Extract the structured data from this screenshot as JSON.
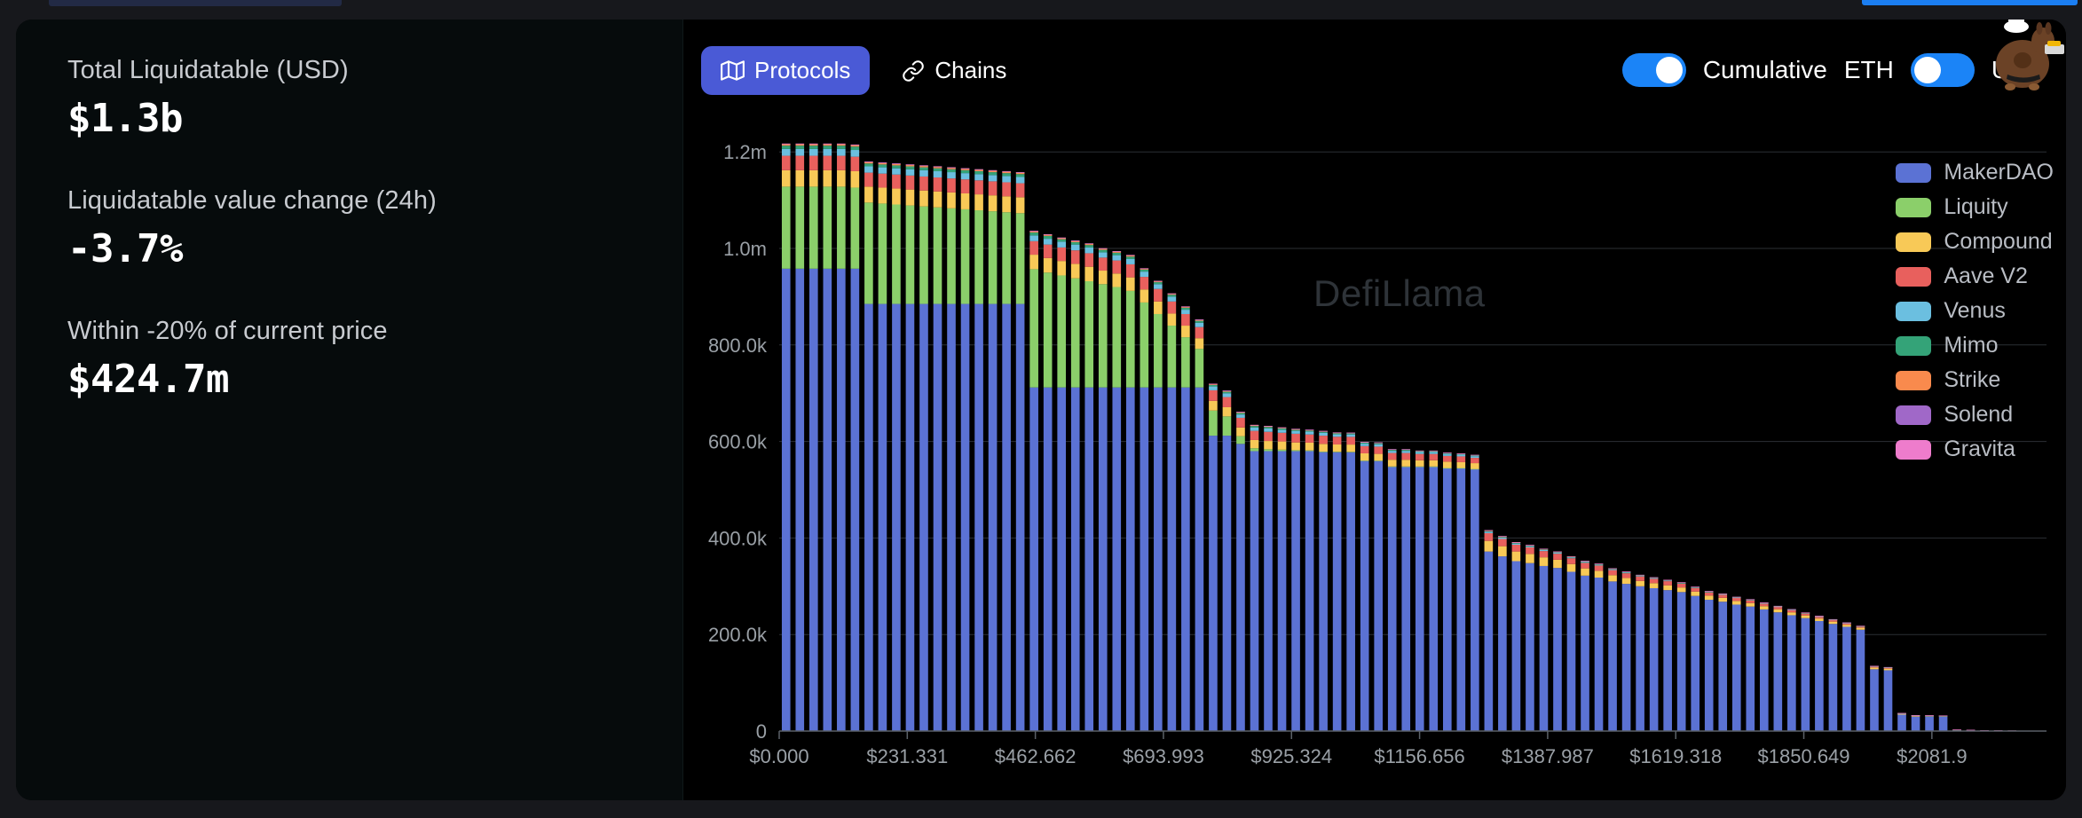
{
  "stats": [
    {
      "label": "Total Liquidatable (USD)",
      "value": "$1.3b"
    },
    {
      "label": "Liquidatable value change (24h)",
      "value": "-3.7%"
    },
    {
      "label": "Within -20% of current price",
      "value": "$424.7m"
    }
  ],
  "toolbar": {
    "tabs": [
      {
        "label": "Protocols",
        "icon": "map-icon",
        "active": true
      },
      {
        "label": "Chains",
        "icon": "link-icon",
        "active": false
      }
    ],
    "cumulative_toggle": {
      "label": "Cumulative",
      "state": "on"
    },
    "currency_toggle": {
      "left_label": "ETH",
      "right_label": "USD",
      "state": "off"
    }
  },
  "watermark": "DefiLlama",
  "colors": {
    "accent_blue": "#4a5ad6",
    "toggle_blue": "#1b84f7",
    "card_bg": "#000000",
    "stats_bg": "#060b0c",
    "grid": "#2b2f34",
    "axis_text": "#9aa0a6"
  },
  "chart_data": {
    "type": "bar",
    "title": "",
    "xlabel": "",
    "ylabel": "",
    "stacked": true,
    "cumulative": true,
    "grid": true,
    "legend_position": "right",
    "ylim": [
      0,
      1250000
    ],
    "ytick_labels": [
      "0",
      "200.0k",
      "400.0k",
      "600.0k",
      "800.0k",
      "1.0m",
      "1.2m"
    ],
    "ytick_values": [
      0,
      200000,
      400000,
      600000,
      800000,
      1000000,
      1200000
    ],
    "xlim": [
      0,
      2289.0
    ],
    "xtick_labels": [
      "$0.000",
      "$231.331",
      "$462.662",
      "$693.993",
      "$925.324",
      "$1156.656",
      "$1387.987",
      "$1619.318",
      "$1850.649",
      "$2081.9"
    ],
    "xtick_values": [
      0.0,
      231.331,
      462.662,
      693.993,
      925.324,
      1156.656,
      1387.987,
      1619.318,
      1850.649,
      2081.98
    ],
    "series": [
      {
        "name": "MakerDAO",
        "color": "#5b72d4",
        "values": [
          958000,
          958000,
          958000,
          958000,
          958000,
          958000,
          885000,
          885000,
          885000,
          885000,
          885000,
          885000,
          885000,
          885000,
          885000,
          885000,
          885000,
          885000,
          712000,
          712000,
          712000,
          712000,
          712000,
          712000,
          712000,
          712000,
          712000,
          712000,
          712000,
          712000,
          712000,
          612000,
          612000,
          595000,
          580000,
          580000,
          580000,
          580000,
          580000,
          578000,
          578000,
          578000,
          560000,
          560000,
          548000,
          548000,
          548000,
          548000,
          545000,
          545000,
          543000,
          372000,
          362000,
          352000,
          348000,
          342000,
          338000,
          330000,
          322000,
          318000,
          310000,
          305000,
          300000,
          296000,
          292000,
          288000,
          280000,
          272000,
          268000,
          262000,
          258000,
          252000,
          246000,
          240000,
          234000,
          228000,
          222000,
          216000,
          210000,
          128000,
          126000,
          34000,
          30000,
          30000,
          30000,
          2000,
          1500,
          1000,
          800,
          600,
          400,
          300
        ]
      },
      {
        "name": "Liquity",
        "color": "#8bcf6a",
        "values": [
          170000,
          170000,
          170000,
          170000,
          170000,
          168000,
          210000,
          208000,
          206000,
          204000,
          202000,
          200000,
          198000,
          196000,
          194000,
          192000,
          190000,
          188000,
          245000,
          238000,
          232000,
          226000,
          220000,
          214000,
          208000,
          200000,
          176000,
          152000,
          128000,
          104000,
          80000,
          52000,
          40000,
          16000,
          6000,
          4000,
          3000,
          2000,
          1500,
          1000,
          800,
          600,
          400,
          300,
          200,
          150,
          120,
          100,
          80,
          60,
          50,
          0,
          0,
          0,
          0,
          0,
          0,
          0,
          0,
          0,
          0,
          0,
          0,
          0,
          0,
          0,
          0,
          0,
          0,
          0,
          0,
          0,
          0,
          0,
          0,
          0,
          0,
          0,
          0,
          0,
          0,
          0,
          0,
          0,
          0,
          0,
          0,
          0,
          0,
          0,
          0,
          0
        ]
      },
      {
        "name": "Compound",
        "color": "#f8c957",
        "values": [
          34000,
          34000,
          34000,
          34000,
          34000,
          34000,
          33000,
          33000,
          33000,
          33000,
          33000,
          33000,
          33000,
          33000,
          33000,
          33000,
          33000,
          33000,
          30000,
          30000,
          30000,
          30000,
          30000,
          28000,
          28000,
          28000,
          27000,
          26000,
          25000,
          24000,
          22000,
          20000,
          19000,
          18000,
          17000,
          17000,
          17000,
          16000,
          16000,
          16000,
          15000,
          15000,
          15000,
          14000,
          14000,
          14000,
          13000,
          13000,
          13000,
          12000,
          12000,
          22000,
          21000,
          20000,
          19000,
          18000,
          17000,
          16000,
          15000,
          14000,
          13000,
          12000,
          11000,
          10500,
          10000,
          9500,
          9000,
          8500,
          8000,
          7600,
          7200,
          6800,
          6400,
          6000,
          5600,
          5200,
          4800,
          4400,
          4000,
          3600,
          3400,
          1600,
          1400,
          1200,
          1000,
          300,
          250,
          200,
          160,
          120,
          90,
          60
        ]
      },
      {
        "name": "Aave V2",
        "color": "#e8605d",
        "values": [
          30000,
          30000,
          30000,
          30000,
          30000,
          30000,
          29000,
          29000,
          29000,
          29000,
          29000,
          29000,
          29000,
          29000,
          29000,
          29000,
          29000,
          29000,
          28000,
          28000,
          28000,
          28000,
          28000,
          27000,
          27000,
          27000,
          26000,
          26000,
          25000,
          24000,
          23000,
          22000,
          21000,
          20000,
          19000,
          19000,
          18000,
          18000,
          17000,
          17000,
          16000,
          16000,
          15000,
          15000,
          14000,
          14000,
          13000,
          13000,
          12000,
          12000,
          11000,
          16000,
          15000,
          14000,
          13500,
          13000,
          12500,
          12000,
          11500,
          11000,
          10500,
          10000,
          9500,
          9000,
          8500,
          8000,
          7500,
          7000,
          6600,
          6200,
          5800,
          5400,
          5000,
          4600,
          4200,
          3800,
          3400,
          3000,
          2600,
          2200,
          2000,
          900,
          800,
          700,
          600,
          200,
          160,
          130,
          100,
          80,
          60,
          40
        ]
      },
      {
        "name": "Venus",
        "color": "#6bbfe0",
        "values": [
          14000,
          14000,
          14000,
          14000,
          14000,
          14000,
          13000,
          13000,
          13000,
          13000,
          13000,
          13000,
          13000,
          13000,
          13000,
          13000,
          13000,
          13000,
          12000,
          12000,
          12000,
          12000,
          12000,
          11000,
          11000,
          11000,
          11000,
          10000,
          10000,
          9000,
          9000,
          8000,
          8000,
          7000,
          7000,
          7000,
          6000,
          6000,
          6000,
          6000,
          5000,
          5000,
          5000,
          5000,
          4500,
          4500,
          4000,
          4000,
          4000,
          3500,
          3500,
          3000,
          2800,
          2600,
          2400,
          2200,
          2000,
          1900,
          1800,
          1700,
          1600,
          1500,
          1400,
          1300,
          1200,
          1100,
          1000,
          950,
          900,
          850,
          800,
          750,
          700,
          650,
          600,
          550,
          500,
          450,
          400,
          300,
          280,
          120,
          110,
          100,
          90,
          40,
          35,
          30,
          25,
          20,
          15,
          10
        ]
      },
      {
        "name": "Mimo",
        "color": "#34a378",
        "values": [
          7000,
          7000,
          7000,
          7000,
          7000,
          7000,
          6000,
          6000,
          6000,
          6000,
          6000,
          6000,
          6000,
          6000,
          6000,
          6000,
          6000,
          6000,
          6000,
          6000,
          5000,
          5000,
          5000,
          5000,
          5000,
          5000,
          4000,
          4000,
          4000,
          4000,
          4000,
          3000,
          3000,
          3000,
          3000,
          3000,
          3000,
          2000,
          2000,
          2000,
          2000,
          2000,
          2000,
          2000,
          1800,
          1800,
          1600,
          1600,
          1500,
          1400,
          1400,
          1200,
          1100,
          1000,
          950,
          900,
          850,
          800,
          750,
          700,
          650,
          600,
          550,
          500,
          480,
          460,
          440,
          420,
          400,
          380,
          360,
          340,
          320,
          300,
          280,
          260,
          240,
          220,
          200,
          150,
          140,
          60,
          55,
          50,
          45,
          20,
          18,
          15,
          12,
          10,
          8,
          5
        ]
      },
      {
        "name": "Strike",
        "color": "#f98a4d",
        "values": [
          3000,
          3000,
          3000,
          3000,
          3000,
          3000,
          3000,
          3000,
          3000,
          3000,
          3000,
          3000,
          3000,
          3000,
          3000,
          3000,
          3000,
          3000,
          2500,
          2500,
          2500,
          2500,
          2500,
          2500,
          2500,
          2500,
          2000,
          2000,
          2000,
          2000,
          2000,
          2000,
          1800,
          1800,
          1800,
          1600,
          1600,
          1600,
          1400,
          1400,
          1400,
          1200,
          1200,
          1200,
          1100,
          1100,
          1000,
          1000,
          950,
          900,
          900,
          1800,
          1700,
          1600,
          1500,
          1450,
          1400,
          1350,
          1300,
          1250,
          1200,
          1150,
          1100,
          1050,
          1000,
          950,
          900,
          880,
          860,
          840,
          820,
          800,
          780,
          760,
          740,
          720,
          700,
          680,
          660,
          600,
          580,
          500,
          480,
          460,
          440,
          400,
          380,
          360,
          340,
          320,
          300,
          280
        ]
      },
      {
        "name": "Solend",
        "color": "#a068c8",
        "values": [
          800,
          800,
          800,
          800,
          800,
          800,
          700,
          700,
          700,
          700,
          700,
          700,
          700,
          700,
          700,
          700,
          700,
          700,
          600,
          600,
          600,
          600,
          600,
          600,
          600,
          600,
          500,
          500,
          500,
          500,
          500,
          400,
          400,
          400,
          400,
          400,
          350,
          350,
          350,
          300,
          300,
          300,
          300,
          300,
          250,
          250,
          250,
          250,
          200,
          200,
          200,
          180,
          170,
          160,
          150,
          140,
          130,
          125,
          120,
          115,
          110,
          105,
          100,
          95,
          90,
          85,
          80,
          78,
          76,
          74,
          72,
          70,
          68,
          66,
          64,
          62,
          60,
          58,
          56,
          50,
          48,
          30,
          28,
          26,
          24,
          12,
          11,
          10,
          9,
          8,
          7,
          6
        ]
      },
      {
        "name": "Gravita",
        "color": "#ee7ccc",
        "values": [
          500,
          500,
          500,
          500,
          500,
          500,
          450,
          450,
          450,
          450,
          450,
          450,
          450,
          450,
          450,
          450,
          450,
          450,
          400,
          400,
          400,
          400,
          400,
          400,
          400,
          400,
          350,
          350,
          350,
          350,
          350,
          300,
          300,
          300,
          300,
          300,
          250,
          250,
          250,
          200,
          200,
          200,
          200,
          200,
          180,
          180,
          180,
          180,
          150,
          150,
          150,
          120,
          115,
          110,
          105,
          100,
          95,
          90,
          85,
          80,
          75,
          70,
          68,
          66,
          64,
          62,
          60,
          58,
          56,
          54,
          52,
          50,
          48,
          46,
          44,
          42,
          40,
          38,
          36,
          30,
          28,
          18,
          16,
          14,
          12,
          8,
          7,
          6,
          5,
          4,
          3,
          2
        ]
      }
    ]
  }
}
